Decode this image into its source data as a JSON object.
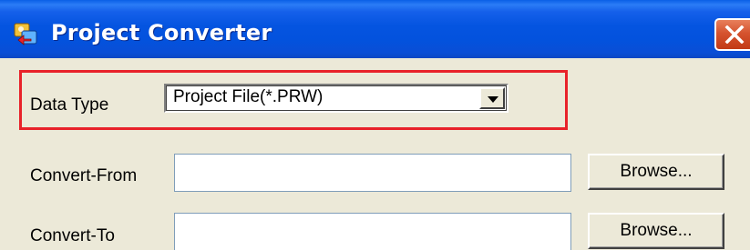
{
  "window": {
    "title": "Project Converter",
    "icon": "project-converter-app-icon",
    "close_icon": "close-icon",
    "colors": {
      "titlebar": "#0454e0",
      "close_button": "#d5532f",
      "highlight_border": "#e8222a",
      "background": "#ece9d8"
    }
  },
  "form": {
    "data_type": {
      "label": "Data Type",
      "selected": "Project File(*.PRW)",
      "dropdown_icon": "chevron-down-icon"
    },
    "convert_from": {
      "label": "Convert-From",
      "value": "",
      "browse_label": "Browse..."
    },
    "convert_to": {
      "label": "Convert-To",
      "value": "",
      "browse_label": "Browse..."
    }
  }
}
